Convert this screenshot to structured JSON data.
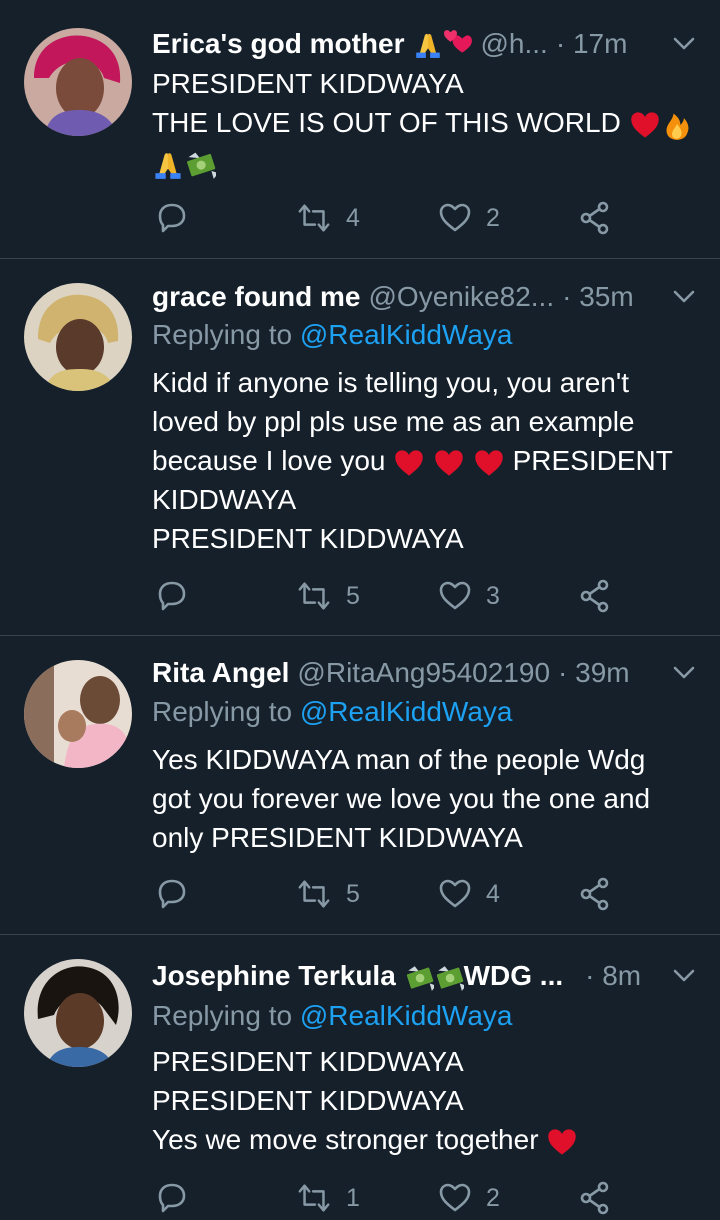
{
  "tweets": [
    {
      "name": "Erica's god mother",
      "name_emojis": [
        "folded-hands-emoji",
        "two-hearts-emoji"
      ],
      "handle": "@h...",
      "time": "· 17m",
      "replying_prefix": "",
      "replying_to": "",
      "lines": [
        "PRESIDENT KIDDWAYA",
        "THE LOVE IS OUT OF THIS WORLD"
      ],
      "line2_emojis": [
        "red-heart-emoji",
        "fire-emoji"
      ],
      "line3_emojis": [
        "folded-hands-emoji",
        "money-with-wings-emoji"
      ],
      "retweets": "4",
      "likes": "2"
    },
    {
      "name": "grace found me",
      "handle": "@Oyenike82...",
      "time": "· 35m",
      "replying_prefix": "Replying to",
      "replying_to": "@RealKiddWaya",
      "lines": [
        "Kidd if anyone is telling you, you aren't",
        "loved by ppl pls use me as an example",
        "because I love you",
        "PRESIDENT",
        "KIDDWAYA",
        "PRESIDENT KIDDWAYA"
      ],
      "retweets": "5",
      "likes": "3"
    },
    {
      "name": "Rita Angel",
      "handle": "@RitaAng95402190",
      "time": "· 39m",
      "replying_prefix": "Replying to",
      "replying_to": "@RealKiddWaya",
      "lines": [
        "Yes KIDDWAYA man of the people Wdg",
        "got you forever we love you the one and",
        "only PRESIDENT KIDDWAYA"
      ],
      "retweets": "5",
      "likes": "4"
    },
    {
      "name": "Josephine Terkula",
      "name_suffix": "WDG ...",
      "handle": "",
      "time": "· 8m",
      "replying_prefix": "Replying to",
      "replying_to": "@RealKiddWaya",
      "lines": [
        "PRESIDENT KIDDWAYA",
        "PRESIDENT KIDDWAYA",
        "Yes we move stronger together"
      ],
      "retweets": "1",
      "likes": "2"
    }
  ],
  "colors": {
    "background": "#15202b",
    "divider": "#38444d",
    "secondary_text": "#8899a6",
    "mention": "#1da1f2",
    "primary_text": "#ffffff"
  },
  "icons": [
    "reply-icon",
    "retweet-icon",
    "like-icon",
    "share-icon",
    "chevron-down-icon"
  ]
}
